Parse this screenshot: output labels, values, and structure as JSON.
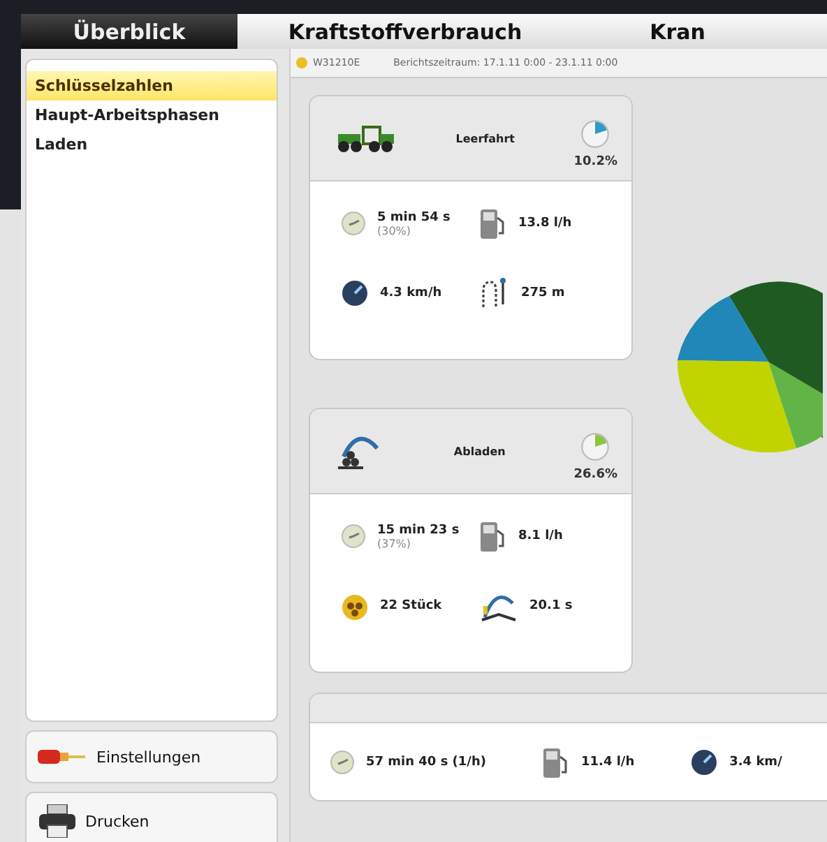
{
  "tabs": [
    {
      "label": "Überblick",
      "selected": true
    },
    {
      "label": "Kraftstoffverbrauch",
      "selected": false
    },
    {
      "label": "Kran",
      "selected": false
    }
  ],
  "sidebar": {
    "items": [
      {
        "label": "Schlüsselzahlen",
        "selected": true
      },
      {
        "label": "Haupt-Arbeitsphasen",
        "selected": false
      },
      {
        "label": "Laden",
        "selected": false
      }
    ],
    "buttons": [
      {
        "kind": "settings",
        "label": "Einstellungen"
      },
      {
        "kind": "print",
        "label": "Drucken"
      }
    ]
  },
  "header": {
    "machine": "W31210E",
    "period": "Berichtszeitraum: 17.1.11 0:00 - 23.1.11 0:00"
  },
  "phases": [
    {
      "kind": "drive",
      "title": "Leerfahrt",
      "percent": "10.2%",
      "stats": [
        {
          "kind": "clock",
          "value": "5 min 54 s",
          "sub": "(30%)"
        },
        {
          "kind": "fuel",
          "value": "13.8 l/h"
        },
        {
          "kind": "speed",
          "value": "4.3 km/h"
        },
        {
          "kind": "distance",
          "value": "275 m"
        }
      ]
    },
    {
      "kind": "unload",
      "title": "Abladen",
      "percent": "26.6%",
      "stats": [
        {
          "kind": "clock",
          "value": "15 min 23 s",
          "sub": "(37%)"
        },
        {
          "kind": "fuel",
          "value": "8.1 l/h"
        },
        {
          "kind": "pieces",
          "value": "22 Stück"
        },
        {
          "kind": "cycle",
          "value": "20.1 s"
        }
      ]
    }
  ],
  "summary": [
    {
      "kind": "clock",
      "value": "57 min 40 s (1/h)"
    },
    {
      "kind": "fuel",
      "value": "11.4 l/h"
    },
    {
      "kind": "speed",
      "value": "3.4 km/"
    }
  ]
}
